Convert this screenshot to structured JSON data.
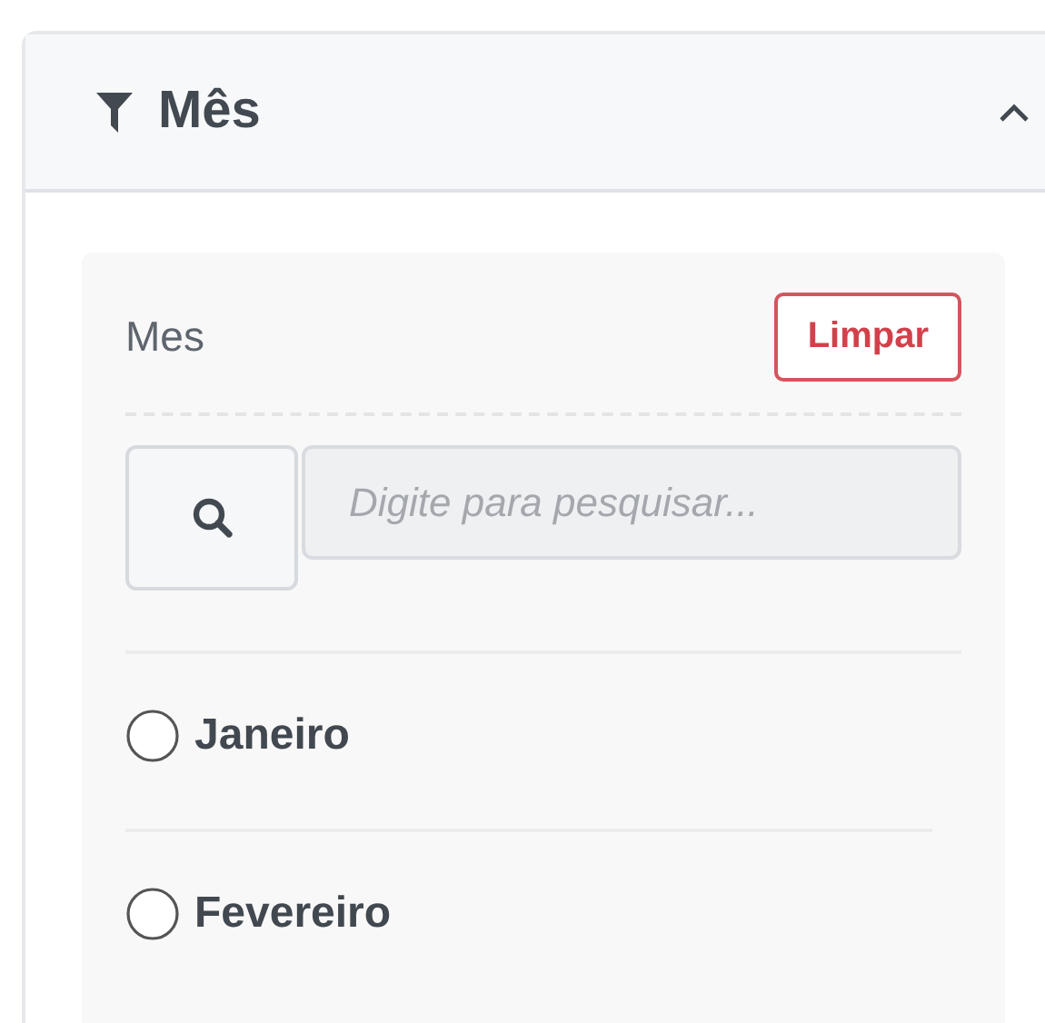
{
  "panel": {
    "title": "Mês",
    "expanded": true
  },
  "filter": {
    "label": "Mes",
    "clear_button": "Limpar",
    "search": {
      "placeholder": "Digite para pesquisar..."
    },
    "options": [
      {
        "label": "Janeiro",
        "selected": false
      },
      {
        "label": "Fevereiro",
        "selected": false
      }
    ]
  }
}
